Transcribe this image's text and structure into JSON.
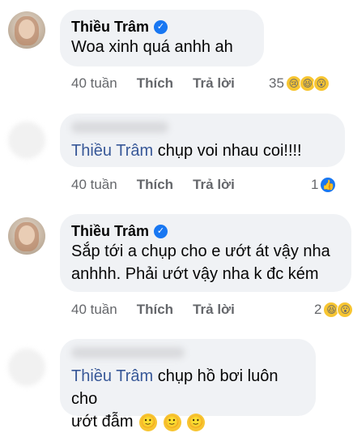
{
  "comments": [
    {
      "author": "Thiều Trâm",
      "text": "Woa xinh quá anhh ah",
      "time": "40 tuần",
      "like": "Thích",
      "reply": "Trả lời",
      "reaction_count": "35",
      "reactions": [
        "sad-icon",
        "haha-icon",
        "wow-icon"
      ]
    },
    {
      "mention": "Thiều Trâm",
      "text": "chụp voi nhau coi!!!!",
      "time": "40 tuần",
      "like": "Thích",
      "reply": "Trả lời",
      "reaction_count": "1",
      "reactions": [
        "like-icon"
      ]
    },
    {
      "author": "Thiều Trâm",
      "text_line1": "Sắp tới a chụp cho e ướt át vậy nha",
      "text_line2": "anhhh. Phải ướt vậy nha k đc kém",
      "time": "40 tuần",
      "like": "Thích",
      "reply": "Trả lời",
      "reaction_count": "2",
      "reactions": [
        "haha-icon",
        "wow-icon"
      ]
    },
    {
      "mention": "Thiều Trâm",
      "text_line1": "chụp hồ bơi luôn cho",
      "text_line2": "ướt đẫm",
      "emojis": [
        "smile-icon",
        "smile-icon",
        "smile-icon"
      ]
    }
  ]
}
